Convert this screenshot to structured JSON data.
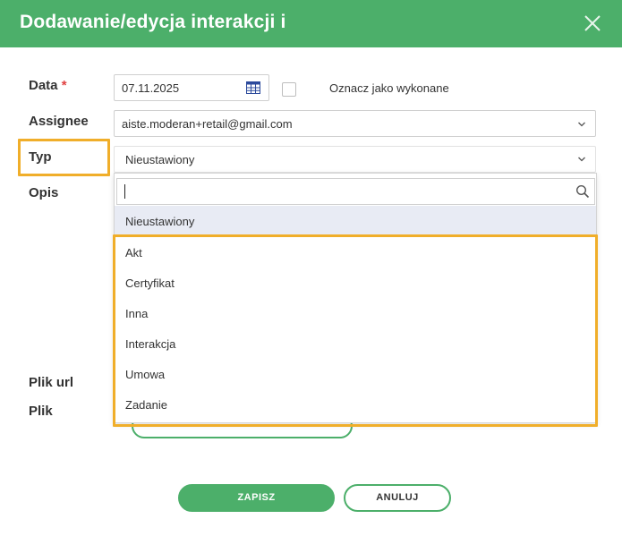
{
  "dialog": {
    "title": "Dodawanie/edycja interakcji i"
  },
  "form": {
    "date_label": "Data",
    "required_marker": "*",
    "date_value": "07.11.2025",
    "mark_done_label": "Oznacz jako wykonane",
    "mark_done_checked": false,
    "assignee_label": "Assignee",
    "assignee_value": "aiste.moderan+retail@gmail.com",
    "type_label": "Typ",
    "type_value": "Nieustawiony",
    "description_label": "Opis",
    "file_url_label": "Plik url",
    "file_label": "Plik"
  },
  "type_dropdown": {
    "search_value": "",
    "options": [
      {
        "label": "Nieustawiony",
        "selected": true
      },
      {
        "label": "Akt",
        "selected": false
      },
      {
        "label": "Certyfikat",
        "selected": false
      },
      {
        "label": "Inna",
        "selected": false
      },
      {
        "label": "Interakcja",
        "selected": false
      },
      {
        "label": "Umowa",
        "selected": false
      },
      {
        "label": "Zadanie",
        "selected": false
      }
    ]
  },
  "actions": {
    "save_label": "ZAPISZ",
    "cancel_label": "ANULUJ"
  },
  "icons": {
    "close": "close-icon",
    "calendar": "calendar-icon",
    "chevron": "chevron-down-icon",
    "search": "search-icon"
  },
  "colors": {
    "primary": "#4caf6a",
    "highlight": "#f0ae2a",
    "required": "#e04040",
    "selected_option_bg": "#e8ebf4"
  }
}
